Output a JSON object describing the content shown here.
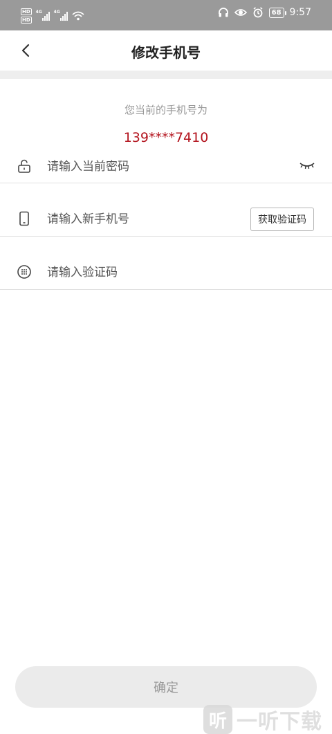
{
  "status_bar": {
    "hd_1": "HD",
    "hd_2": "HD",
    "net_1": "4G",
    "net_2": "4G",
    "battery": "68",
    "time": "9:57"
  },
  "header": {
    "title": "修改手机号"
  },
  "current": {
    "label": "您当前的手机号为",
    "phone": "139****7410",
    "phone_color": "#b3141e"
  },
  "form": {
    "password_placeholder": "请输入当前密码",
    "new_phone_placeholder": "请输入新手机号",
    "get_code_label": "获取验证码",
    "code_placeholder": "请输入验证码"
  },
  "confirm_label": "确定",
  "watermark": {
    "logo_char": "听",
    "text": "一听下载"
  },
  "icons": [
    "back-arrow-icon",
    "unlock-icon",
    "eye-closed-icon",
    "phone-icon",
    "keypad-icon",
    "headphones-icon",
    "eye-icon",
    "alarm-icon",
    "wifi-icon"
  ]
}
